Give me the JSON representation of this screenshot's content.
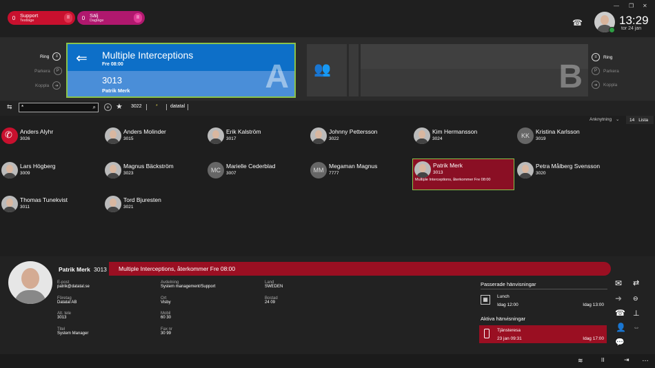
{
  "queues": [
    {
      "count": "0",
      "name": "Support",
      "sub": "Testläge",
      "pause": "II",
      "color": "#c8102e",
      "pauseColor": "#e0334f"
    },
    {
      "count": "0",
      "name": "Sälj",
      "sub": "Dagläge",
      "pause": "II",
      "color": "#b0186e",
      "pauseColor": "#e03a96"
    }
  ],
  "window": {
    "minimize": "—",
    "restore": "❐",
    "close": "✕"
  },
  "user": {
    "time": "13:29",
    "date": "tor 24 jan"
  },
  "lineA": {
    "title": "Multiple Interceptions",
    "subtitle": "Fre 08:00",
    "number": "3013",
    "name": "Patrik Merk",
    "letter": "A"
  },
  "lineB": {
    "letter": "B"
  },
  "leftActions": [
    "Ring",
    "Parkera",
    "Koppla"
  ],
  "rightActions": [
    "Ring",
    "Parkera",
    "Koppla"
  ],
  "search": {
    "value": "*",
    "chip1": "3022",
    "chip2": "*",
    "chip3": "datatal"
  },
  "view": {
    "filter": "Anknytning",
    "count": "14",
    "mode": "Lista"
  },
  "contacts": [
    {
      "name": "Anders Alyhr",
      "ext": "3026",
      "avatar": "photo",
      "ringing": true
    },
    {
      "name": "Anders Molinder",
      "ext": "3015",
      "avatar": "photo"
    },
    {
      "name": "Erik Kalström",
      "ext": "3017",
      "avatar": "photo"
    },
    {
      "name": "Johnny Pettersson",
      "ext": "3022",
      "avatar": "photo"
    },
    {
      "name": "Kim Hermansson",
      "ext": "3024",
      "avatar": "photo"
    },
    {
      "name": "Kristina Karlsson",
      "ext": "3019",
      "avatar": "KK"
    },
    {
      "name": "Lars Högberg",
      "ext": "3009",
      "avatar": "photo"
    },
    {
      "name": "Magnus Bäckström",
      "ext": "3023",
      "avatar": "photo"
    },
    {
      "name": "Marielle Cederblad",
      "ext": "3007",
      "avatar": "MC"
    },
    {
      "name": "Megaman Magnus",
      "ext": "7777",
      "avatar": "MM"
    },
    {
      "name": "Patrik Merk",
      "ext": "3013",
      "avatar": "photo",
      "busy": true,
      "status": "Multiple Interceptions, återkommer Fre 08:00"
    },
    {
      "name": "Petra Målberg Svensson",
      "ext": "3020",
      "avatar": "photo"
    },
    {
      "name": "Thomas Tunekvist",
      "ext": "3011",
      "avatar": "photo"
    },
    {
      "name": "Tord Bjuresten",
      "ext": "3021",
      "avatar": "photo"
    }
  ],
  "detail": {
    "name": "Patrik Merk",
    "ext": "3013",
    "status": "Multiple Interceptions, återkommer Fre 08:00",
    "fields": [
      {
        "label": "E-post",
        "value": "patrik@datatal.se"
      },
      {
        "label": "Företag",
        "value": "Datatal AB"
      },
      {
        "label": "Alt. tele",
        "value": "3013"
      },
      {
        "label": "Titel",
        "value": "System Manager"
      },
      {
        "label": "Avdelning",
        "value": "System management/Support"
      },
      {
        "label": "Ort",
        "value": "Visby"
      },
      {
        "label": "Mobil",
        "value": "60 30"
      },
      {
        "label": "Fax nr",
        "value": "30 99"
      },
      {
        "label": "Land",
        "value": "SWEDEN"
      },
      {
        "label": "Bostad",
        "value": "24 09"
      }
    ],
    "past_heading": "Passerade hänvisningar",
    "past": {
      "title": "Lunch",
      "from": "Idag 12:00",
      "to": "Idag 13:00"
    },
    "active_heading": "Aktiva hänvisningar",
    "active": {
      "title": "Tjänsteresa",
      "from": "23 jan 09:31",
      "to": "Idag 17:00"
    }
  },
  "colors": {
    "accent": "#0d6fc8",
    "busy": "#8a0f24",
    "highlight": "#8bc34a"
  }
}
